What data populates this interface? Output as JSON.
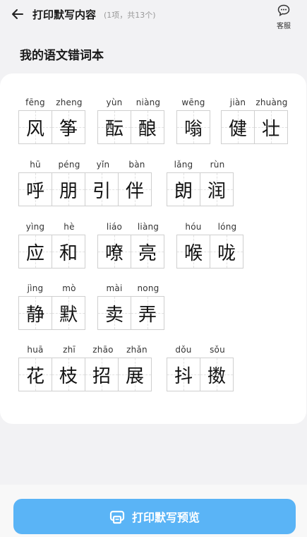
{
  "header": {
    "title": "打印默写内容",
    "subtitle": "(1项，共13个)",
    "service_label": "客服"
  },
  "section_title": "我的语文错词本",
  "words": [
    {
      "pinyin": [
        "fēng",
        "zheng"
      ],
      "chars": [
        "风",
        "筝"
      ]
    },
    {
      "pinyin": [
        "yùn",
        "niàng"
      ],
      "chars": [
        "酝",
        "酿"
      ]
    },
    {
      "pinyin": [
        "wēng"
      ],
      "chars": [
        "嗡"
      ]
    },
    {
      "pinyin": [
        "jiàn",
        "zhuàng"
      ],
      "chars": [
        "健",
        "壮"
      ]
    },
    {
      "pinyin": [
        "hū",
        "péng",
        "yǐn",
        "bàn"
      ],
      "chars": [
        "呼",
        "朋",
        "引",
        "伴"
      ]
    },
    {
      "pinyin": [
        "lǎng",
        "rùn"
      ],
      "chars": [
        "朗",
        "润"
      ]
    },
    {
      "pinyin": [
        "yìng",
        "hè"
      ],
      "chars": [
        "应",
        "和"
      ]
    },
    {
      "pinyin": [
        "liáo",
        "liàng"
      ],
      "chars": [
        "嘹",
        "亮"
      ]
    },
    {
      "pinyin": [
        "hóu",
        "lóng"
      ],
      "chars": [
        "喉",
        "咙"
      ]
    },
    {
      "pinyin": [
        "jìng",
        "mò"
      ],
      "chars": [
        "静",
        "默"
      ]
    },
    {
      "pinyin": [
        "mài",
        "nong"
      ],
      "chars": [
        "卖",
        "弄"
      ]
    },
    {
      "pinyin": [
        "huā",
        "zhī",
        "zhāo",
        "zhǎn"
      ],
      "chars": [
        "花",
        "枝",
        "招",
        "展"
      ]
    },
    {
      "pinyin": [
        "dǒu",
        "sǒu"
      ],
      "chars": [
        "抖",
        "擞"
      ]
    }
  ],
  "print_button_label": "打印默写预览",
  "colors": {
    "accent": "#5ab4f6",
    "background": "#f2f2f4",
    "card": "#ffffff"
  },
  "icons": {
    "back": "arrow-left-icon",
    "service": "chat-bubble-icon",
    "print": "printer-icon"
  }
}
